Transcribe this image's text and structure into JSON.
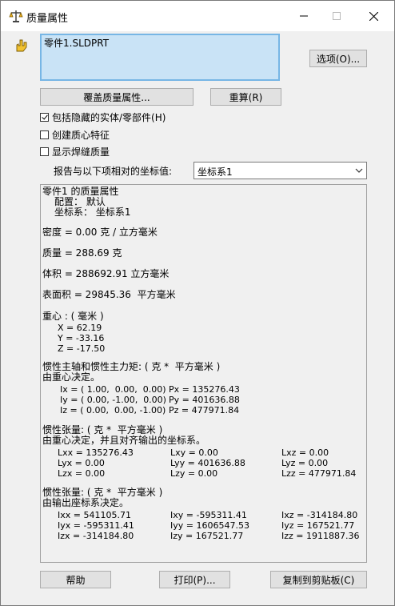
{
  "window": {
    "title": "质量属性",
    "minimize_icon": "minimize-icon",
    "maximize_icon": "maximize-icon",
    "close_icon": "close-icon"
  },
  "part_list": {
    "items": [
      "零件1.SLDPRT"
    ]
  },
  "buttons": {
    "options": "选项(O)...",
    "override": "覆盖质量属性...",
    "recalculate": "重算(R)",
    "help": "帮助",
    "print": "打印(P)...",
    "copy": "复制到剪贴板(C)"
  },
  "checkboxes": [
    {
      "label": "包括隐藏的实体/零部件(H)",
      "checked": true
    },
    {
      "label": "创建质心特征",
      "checked": false
    },
    {
      "label": "显示焊缝质量",
      "checked": false
    }
  ],
  "report": {
    "label": "报告与以下项相对的坐标值:",
    "selected": "坐标系1"
  },
  "results": {
    "heading": "零件1 的质量属性",
    "config": "配置： 默认",
    "coord_sys": "坐标系： 坐标系1",
    "density": "密度 = 0.00 克 / 立方毫米",
    "mass": "质量 = 288.69 克",
    "volume": "体积 = 288692.91 立方毫米",
    "surface_area": "表面积 = 29845.36  平方毫米",
    "centroid_title": "重心 : ( 毫米 )",
    "cx": "X = 62.19",
    "cy": "Y = -33.16",
    "cz": "Z = -17.50",
    "principal_title": "惯性主轴和惯性主力矩: ( 克 *  平方毫米 )",
    "principal_sub": "由重心决定。",
    "ix": "Ix = ( 1.00,  0.00,  0.00)",
    "iy": "Iy = ( 0.00, -1.00,  0.00)",
    "iz": "Iz = ( 0.00,  0.00, -1.00)",
    "px": "Px = 135276.43",
    "py": "Py = 401636.88",
    "pz": "Pz = 477971.84",
    "tensor1_title": "惯性张量: ( 克 *  平方毫米 )",
    "tensor1_sub": "由重心决定，并且对齐输出的坐标系。",
    "t1": [
      [
        "Lxx = 135276.43",
        "Lxy = 0.00",
        "Lxz = 0.00"
      ],
      [
        "Lyx = 0.00",
        "Lyy = 401636.88",
        "Lyz = 0.00"
      ],
      [
        "Lzx = 0.00",
        "Lzy = 0.00",
        "Lzz = 477971.84"
      ]
    ],
    "tensor2_title": "惯性张量: ( 克 *  平方毫米 )",
    "tensor2_sub": "由输出座标系决定。",
    "t2": [
      [
        "Ixx = 541105.71",
        "Ixy = -595311.41",
        "Ixz = -314184.80"
      ],
      [
        "Iyx = -595311.41",
        "Iyy = 1606547.53",
        "Iyz = 167521.77"
      ],
      [
        "Izx = -314184.80",
        "Izy = 167521.77",
        "Izz = 1911887.36"
      ]
    ]
  }
}
